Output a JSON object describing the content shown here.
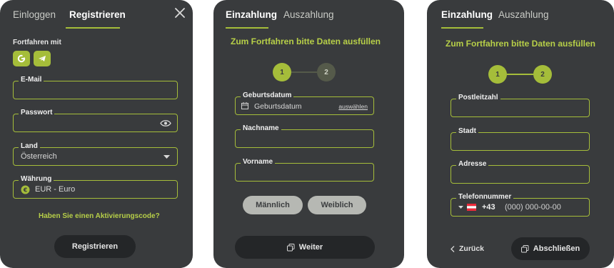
{
  "colors": {
    "accent": "#a5bd3a",
    "panel": "#393b3d",
    "dark_button": "#242628",
    "gender_button": "#b6b8b3"
  },
  "register_panel": {
    "tabs": [
      {
        "label": "Einloggen"
      },
      {
        "label": "Registrieren"
      }
    ],
    "continue_with": "Fortfahren mit",
    "social_icons": [
      "google-icon",
      "telegram-icon"
    ],
    "email": {
      "label": "E-Mail",
      "value": ""
    },
    "password": {
      "label": "Passwort",
      "value": ""
    },
    "country": {
      "label": "Land",
      "value": "Österreich"
    },
    "currency": {
      "label": "Währung",
      "value": "EUR - Euro"
    },
    "activation_link": "Haben Sie einen Aktivierungscode?",
    "submit": "Registrieren"
  },
  "step1_panel": {
    "tabs": [
      {
        "label": "Einzahlung"
      },
      {
        "label": "Auszahlung"
      }
    ],
    "heading": "Zum Fortfahren bitte Daten ausfüllen",
    "steps": [
      "1",
      "2"
    ],
    "active_step": 1,
    "birthdate": {
      "label": "Geburtsdatum",
      "placeholder": "Geburtsdatum",
      "action": "auswählen"
    },
    "lastname": {
      "label": "Nachname",
      "value": ""
    },
    "firstname": {
      "label": "Vorname",
      "value": ""
    },
    "gender": [
      "Männlich",
      "Weiblich"
    ],
    "next": "Weiter"
  },
  "step2_panel": {
    "tabs": [
      {
        "label": "Einzahlung"
      },
      {
        "label": "Auszahlung"
      }
    ],
    "heading": "Zum Fortfahren bitte Daten ausfüllen",
    "steps": [
      "1",
      "2"
    ],
    "active_step": 2,
    "postcode": {
      "label": "Postleitzahl",
      "value": ""
    },
    "city": {
      "label": "Stadt",
      "value": ""
    },
    "address": {
      "label": "Adresse",
      "value": ""
    },
    "phone": {
      "label": "Telefonnummer",
      "prefix": "+43",
      "placeholder": "(000) 000-00-00"
    },
    "back": "Zurück",
    "finish": "Abschließen"
  }
}
